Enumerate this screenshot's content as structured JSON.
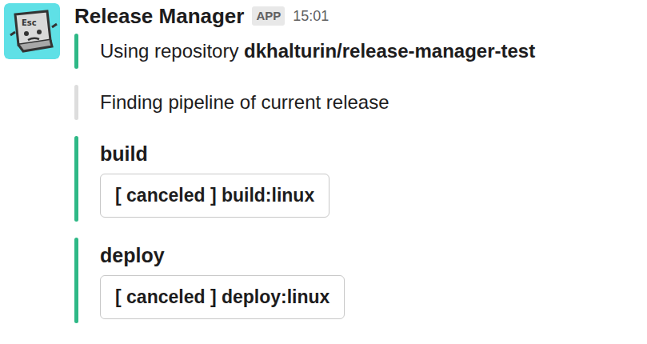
{
  "message": {
    "avatar_label": "Esc",
    "author": "Release Manager",
    "badge": "APP",
    "time": "15:01",
    "attachments": [
      {
        "kind": "text",
        "color": "#2eb886",
        "parts": [
          {
            "text": "Using repository ",
            "bold": false
          },
          {
            "text": "dkhalturin/release-manager-test",
            "bold": true
          }
        ]
      },
      {
        "kind": "text",
        "color": "#dddddd",
        "parts": [
          {
            "text": "Finding pipeline of current release",
            "bold": false
          }
        ]
      },
      {
        "kind": "actions",
        "color": "#2eb886",
        "title": "build",
        "buttons": [
          "[ canceled ] build:linux"
        ]
      },
      {
        "kind": "actions",
        "color": "#2eb886",
        "title": "deploy",
        "buttons": [
          "[ canceled ] deploy:linux"
        ]
      }
    ]
  }
}
